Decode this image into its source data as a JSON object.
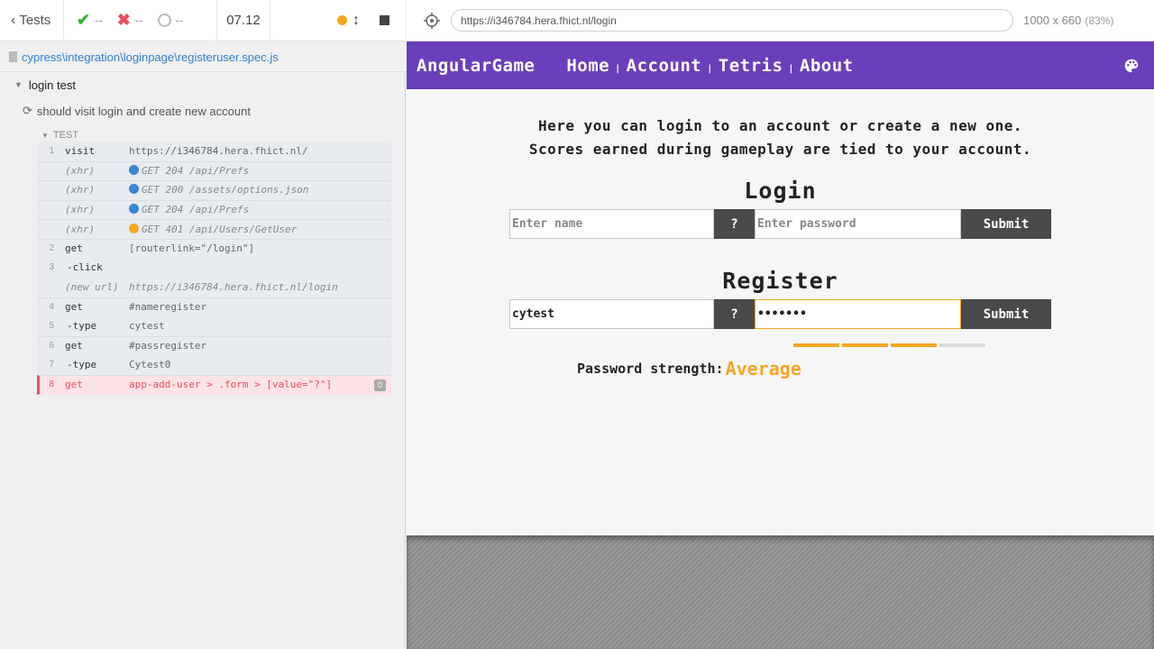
{
  "reporter": {
    "tests_label": "Tests",
    "passed": "--",
    "failed": "--",
    "pending": "--",
    "duration": "07.12",
    "spec_path": "cypress\\integration\\loginpage\\registeruser.spec.js",
    "suite_title": "login test",
    "test_title": "should visit login and create new account",
    "test_section_label": "TEST",
    "status_colors": {
      "running": "#f5a623",
      "pass": "#3db33d",
      "fail": "#e94f5f"
    },
    "commands": [
      {
        "num": "1",
        "name": "visit",
        "msg": "https://i346784.hera.fhict.nl/",
        "kind": "normal"
      },
      {
        "num": "",
        "name": "(xhr)",
        "msg": "GET 204 /api/Prefs",
        "kind": "xhr",
        "dot": "#3a86d4"
      },
      {
        "num": "",
        "name": "(xhr)",
        "msg": "GET 200 /assets/options.json",
        "kind": "xhr",
        "dot": "#3a86d4"
      },
      {
        "num": "",
        "name": "(xhr)",
        "msg": "GET 204 /api/Prefs",
        "kind": "xhr",
        "dot": "#3a86d4"
      },
      {
        "num": "",
        "name": "(xhr)",
        "msg": "GET 401 /api/Users/GetUser",
        "kind": "xhr",
        "dot": "#f5a623"
      },
      {
        "num": "2",
        "name": "get",
        "msg": "[routerlink=\"/login\"]",
        "kind": "normal"
      },
      {
        "num": "3",
        "name": "-click",
        "msg": "",
        "kind": "child"
      },
      {
        "num": "",
        "name": "(new url)",
        "msg": "https://i346784.hera.fhict.nl/login",
        "kind": "newurl"
      },
      {
        "num": "4",
        "name": "get",
        "msg": "#nameregister",
        "kind": "normal"
      },
      {
        "num": "5",
        "name": "-type",
        "msg": "cytest",
        "kind": "child"
      },
      {
        "num": "6",
        "name": "get",
        "msg": "#passregister",
        "kind": "normal"
      },
      {
        "num": "7",
        "name": "-type",
        "msg": "Cytest0",
        "kind": "child"
      },
      {
        "num": "8",
        "name": "get",
        "msg": "app-add-user > .form > [value=\"?\"]",
        "kind": "err",
        "badge": "0"
      }
    ]
  },
  "runner": {
    "url": "https://i346784.hera.fhict.nl/login",
    "viewport": "1000 x 660",
    "zoom": "(83%)"
  },
  "app": {
    "brand": "AngularGame",
    "nav": [
      "Home",
      "Account",
      "Tetris",
      "About"
    ],
    "intro_line1": "Here you can login to an account or create a new one.",
    "intro_line2": "Scores earned during gameplay are tied to your account.",
    "login_title": "Login",
    "login_name_placeholder": "Enter name",
    "login_password_placeholder": "Enter password",
    "help_label": "?",
    "submit_label": "Submit",
    "register_title": "Register",
    "register_name_value": "cytest",
    "register_password_value": "Cytest0",
    "strength_label": "Password strength:",
    "strength_value": "Average",
    "strength_level": 0.75,
    "accent_color": "#6a3fbb"
  }
}
